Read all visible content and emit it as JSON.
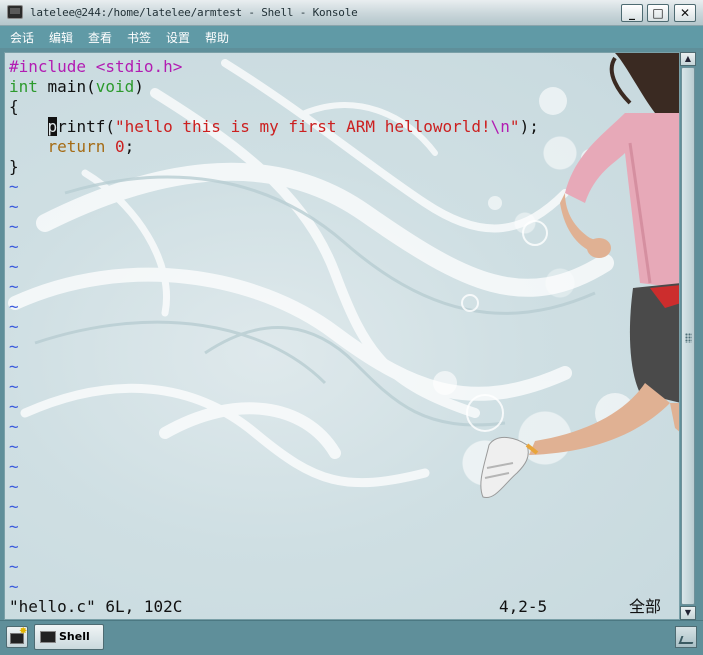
{
  "window": {
    "title": "latelee@244:/home/latelee/armtest - Shell - Konsole",
    "buttons": {
      "minimize": "_",
      "maximize": "□",
      "close": "✕"
    }
  },
  "menubar": {
    "items": [
      "会话",
      "编辑",
      "查看",
      "书签",
      "设置",
      "帮助"
    ]
  },
  "editor": {
    "lines": [
      {
        "parts": [
          {
            "cls": "c-pre",
            "text": "#include <stdio.h>"
          }
        ]
      },
      {
        "parts": [
          {
            "cls": "c-type",
            "text": "int"
          },
          {
            "cls": "",
            "text": " main("
          },
          {
            "cls": "c-type",
            "text": "void"
          },
          {
            "cls": "",
            "text": ")"
          }
        ]
      },
      {
        "parts": [
          {
            "cls": "",
            "text": "{"
          }
        ]
      },
      {
        "parts": [
          {
            "cls": "",
            "text": "    "
          },
          {
            "cls": "cursor",
            "text": "p"
          },
          {
            "cls": "",
            "text": "rintf("
          },
          {
            "cls": "c-str",
            "text": "\"hello this is my first ARM helloworld!"
          },
          {
            "cls": "c-esc",
            "text": "\\n"
          },
          {
            "cls": "c-str",
            "text": "\""
          },
          {
            "cls": "",
            "text": ");"
          }
        ]
      },
      {
        "parts": [
          {
            "cls": "",
            "text": "    "
          },
          {
            "cls": "c-kw",
            "text": "return"
          },
          {
            "cls": "",
            "text": " "
          },
          {
            "cls": "c-num",
            "text": "0"
          },
          {
            "cls": "",
            "text": ";"
          }
        ]
      },
      {
        "parts": [
          {
            "cls": "",
            "text": "}"
          }
        ]
      }
    ],
    "tilde_char": "~",
    "tilde_count": 21
  },
  "status": {
    "file": "\"hello.c\" 6L, 102C",
    "position": "4,2-5",
    "percent": "全部"
  },
  "scrollbar": {
    "up_arrow": "▲",
    "down_arrow": "▼"
  },
  "tabs": {
    "items": [
      {
        "label": "Shell"
      }
    ]
  },
  "colors": {
    "menubar": "#609aa6",
    "preprocessor": "#b21cb2",
    "type": "#2c9a2c",
    "string": "#cc2020",
    "keyword": "#a56b14",
    "tilde": "#3a5adc"
  },
  "icons": [
    "konsole-icon",
    "new-session-icon",
    "terminal-tab-icon",
    "scroll-up-icon",
    "scroll-down-icon",
    "grip-icon",
    "resize-icon"
  ]
}
